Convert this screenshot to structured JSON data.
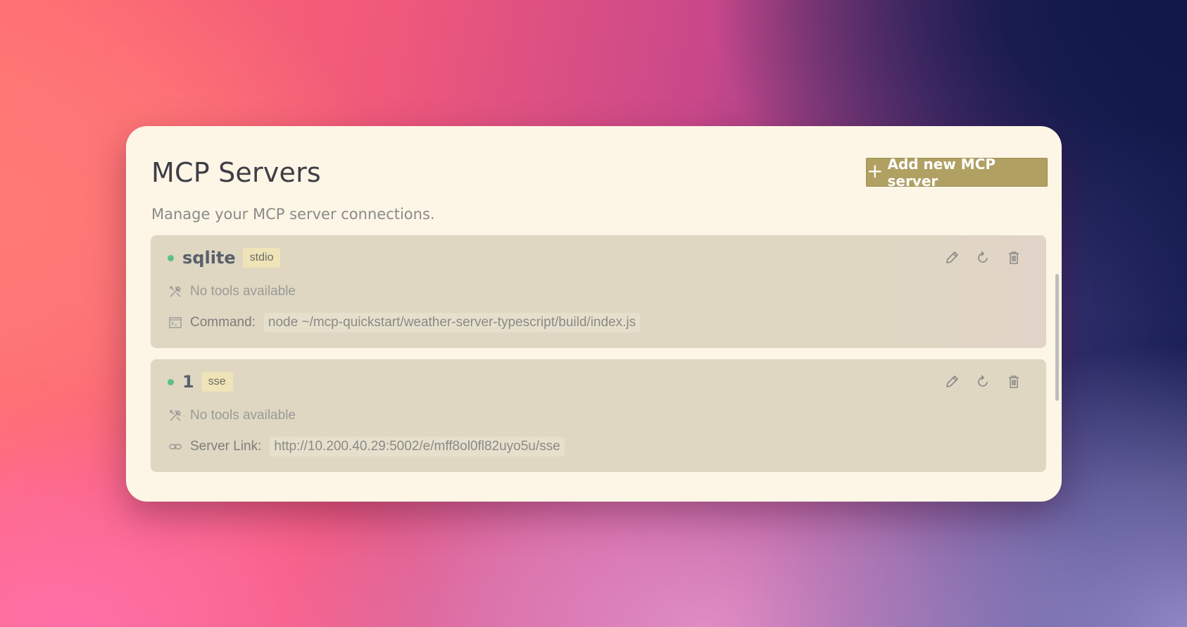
{
  "header": {
    "title": "MCP Servers",
    "subtitle": "Manage your MCP server connections.",
    "add_button_label": "Add new MCP server"
  },
  "servers": [
    {
      "name": "sqlite",
      "type": "stdio",
      "status_color": "#5fbf86",
      "tools_text": "No tools available",
      "detail_label": "Command:",
      "detail_value": "node ~/mcp-quickstart/weather-server-typescript/build/index.js",
      "detail_icon": "terminal-icon"
    },
    {
      "name": "1",
      "type": "sse",
      "status_color": "#5fbf86",
      "tools_text": "No tools available",
      "detail_label": "Server Link:",
      "detail_value": "http://10.200.40.29:5002/e/mff8ol0fl82uyo5u/sse",
      "detail_icon": "link-icon"
    }
  ],
  "colors": {
    "panel_bg": "#fdf6e6",
    "card_bg": "#dfd7c2",
    "accent_button": "#b0a062",
    "status_online": "#5fbf86"
  },
  "icons": {
    "add": "plus-icon",
    "edit": "pencil-icon",
    "refresh": "refresh-icon",
    "delete": "trash-icon",
    "tools": "tools-icon"
  }
}
